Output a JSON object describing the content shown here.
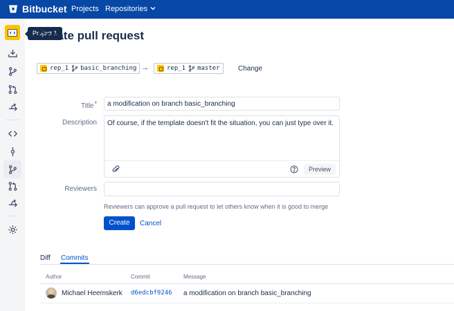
{
  "app": {
    "brand": "Bitbucket",
    "nav": {
      "projects": "Projects",
      "repositories": "Repositories"
    }
  },
  "sidebar": {
    "tooltip": "Project 1",
    "icons": [
      "folder-icon",
      "clone-icon",
      "branches-icon",
      "pull-requests-icon",
      "forks-icon",
      "source-icon",
      "commits-icon",
      "branches-icon",
      "pull-requests-icon",
      "forks-icon",
      "settings-icon"
    ]
  },
  "page": {
    "title": "Create pull request"
  },
  "branches": {
    "from": {
      "repo": "rep_1",
      "branch": "basic_branching"
    },
    "arrow": "→",
    "to": {
      "repo": "rep_1",
      "branch": "master"
    },
    "change": "Change"
  },
  "form": {
    "title_label": "Title",
    "required_mark": "*",
    "title_value": "a modification on branch basic_branching",
    "description_label": "Description",
    "description_value": "Of course, if the template doesn't fit the situation, you can just type over it.",
    "preview": "Preview",
    "reviewers_label": "Reviewers",
    "reviewers_value": "",
    "reviewers_hint": "Reviewers can approve a pull request to let others know when it is good to merge",
    "create": "Create",
    "cancel": "Cancel"
  },
  "tabs": {
    "diff": "Diff",
    "commits": "Commits"
  },
  "commits_table": {
    "headers": {
      "author": "Author",
      "commit": "Commit",
      "message": "Message"
    },
    "rows": [
      {
        "author": "Michael Heemskerk",
        "commit": "d6edcbf9246",
        "message": "a modification on branch basic_branching"
      }
    ]
  },
  "colors": {
    "topbar": "#0747a6",
    "primary": "#0052cc",
    "project_avatar": "#ffc400"
  }
}
